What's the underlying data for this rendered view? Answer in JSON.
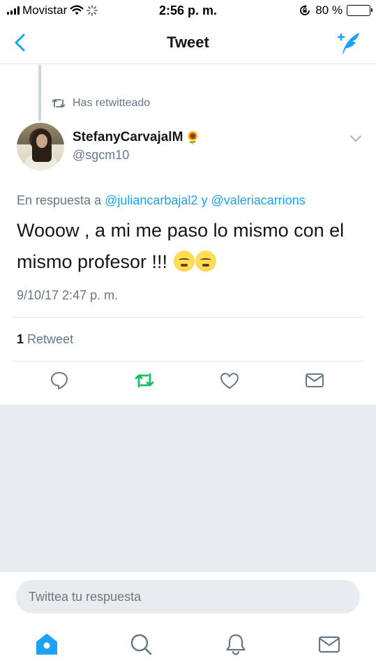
{
  "status_bar": {
    "carrier": "Movistar",
    "time": "2:56 p. m.",
    "battery": "80 %",
    "battery_level": 0.8,
    "icons": [
      "signal-icon",
      "wifi-icon",
      "loading-icon",
      "rotation-lock-icon",
      "battery-icon"
    ]
  },
  "nav": {
    "title": "Tweet",
    "back_icon": "chevron-left-icon",
    "compose_icon": "compose-tweet-icon"
  },
  "tweet": {
    "retweet_notice": "Has retwitteado",
    "author_name": "StefanyCarvajalM",
    "author_emoji": "🌻",
    "author_handle": "@sgcm10",
    "reply_prefix": "En respuesta a",
    "reply_mention_1": "@juliancarbajal2",
    "reply_joiner": "y",
    "reply_mention_2": "@valeriacarrions",
    "text": "Wooow , a mi me paso lo mismo con el mismo profesor !!!",
    "emoji_count": 2,
    "timestamp": "9/10/17 2:47 p. m.",
    "retweet_count": "1",
    "retweet_label": "Retweet"
  },
  "actions": [
    {
      "name": "reply-icon"
    },
    {
      "name": "retweet-icon",
      "active": true
    },
    {
      "name": "like-icon"
    },
    {
      "name": "direct-message-icon"
    }
  ],
  "reply_bar": {
    "placeholder": "Twittea tu respuesta"
  },
  "tabs": [
    {
      "name": "home-icon",
      "active": true
    },
    {
      "name": "search-icon"
    },
    {
      "name": "notifications-icon"
    },
    {
      "name": "messages-icon"
    }
  ],
  "colors": {
    "accent": "#1da1f2",
    "retweet_green": "#17bf63",
    "secondary_text": "#657786",
    "divider": "#e1e8ed",
    "background_gray": "#e6ecf0"
  }
}
